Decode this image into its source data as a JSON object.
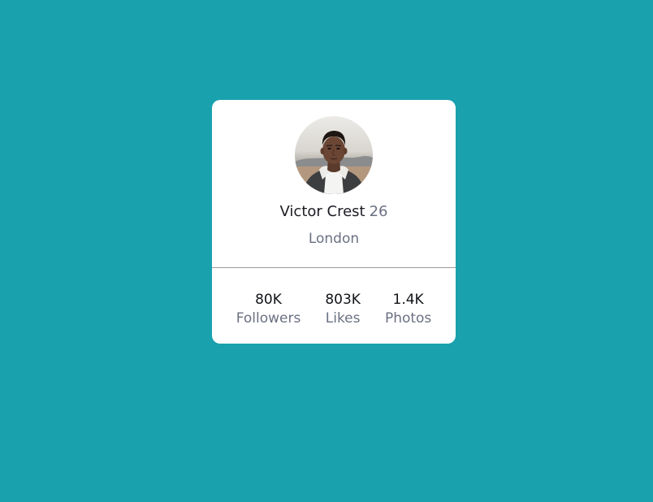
{
  "colors": {
    "page_background": "#19a1ae",
    "card_background": "#ffffff",
    "primary_text": "#1c1c24",
    "secondary_text": "#6b7082",
    "divider": "#9a9a9a"
  },
  "profile": {
    "avatar_icon": "profile-photo",
    "name": "Victor Crest",
    "age": "26",
    "city": "London"
  },
  "stats": [
    {
      "value": "80K",
      "label": "Followers"
    },
    {
      "value": "803K",
      "label": "Likes"
    },
    {
      "value": "1.4K",
      "label": "Photos"
    }
  ]
}
